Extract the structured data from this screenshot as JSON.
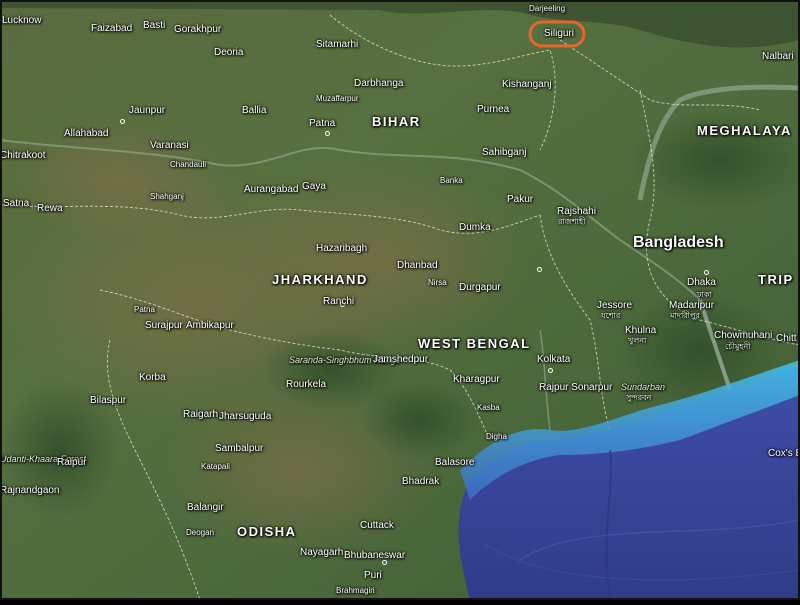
{
  "map": {
    "countries": [
      "Bangladesh"
    ],
    "states": [
      "BIHAR",
      "JHARKHAND",
      "WEST BENGAL",
      "ODISHA",
      "MEGHALAYA",
      "TRIP"
    ],
    "cities": [
      "Lucknow",
      "Faizabad",
      "Basti",
      "Gorakhpur",
      "Deoria",
      "Sitamarhi",
      "Darjeeling",
      "Siliguri",
      "Nalbari",
      "Darbhanga",
      "Muzaffarpur",
      "Kishanganj",
      "Jaunpur",
      "Ballia",
      "Purnea",
      "Allahabad",
      "Varanasi",
      "Patna",
      "Chitrakoot",
      "Chandauli",
      "Sahibganj",
      "Shahganj",
      "Aurangabad",
      "Gaya",
      "Banka",
      "Satna",
      "Rewa",
      "Pakur",
      "Rajshahi",
      "Dumka",
      "Hazaribagh",
      "Dhanbad",
      "Nirsa",
      "Durgapur",
      "Dhaka",
      "Ranchi",
      "Surajpur",
      "Ambikapur",
      "Jessore",
      "Madaripur",
      "Khulna",
      "Chowmuhani",
      "Jamshedpur",
      "Kolkata",
      "Korba",
      "Rourkela",
      "Kharagpur",
      "Rajpur Sonarpur",
      "Bilaspur",
      "Raigarh",
      "Jharsuguda",
      "Kasba",
      "Digha",
      "Raipur",
      "Sambalpur",
      "Katapali",
      "Balasore",
      "Rajnandgaon",
      "Bhadrak",
      "Balangir",
      "Cuttack",
      "Deogan",
      "Nayagarh",
      "Bhubaneswar",
      "Puri",
      "Brahmagiri",
      "Cox's Bazar",
      "Chitt"
    ],
    "bengali": [
      "রাজশাহী",
      "ঢাকা",
      "যশোর",
      "মাদারীপুর",
      "খুলনা",
      "চৌমুহনী",
      "সুন্দরবন"
    ],
    "features": [
      "Saranda-Singhbhum Range",
      "Sundarban",
      "Udanti-Khaara Forest",
      "Patna"
    ],
    "highlight": "Siliguri",
    "colors": {
      "highlight": "#e8652b",
      "sea_deep": "#3f4fa0",
      "sea_shallow": "#3fb7e0",
      "land": "#4f6a3e"
    }
  }
}
